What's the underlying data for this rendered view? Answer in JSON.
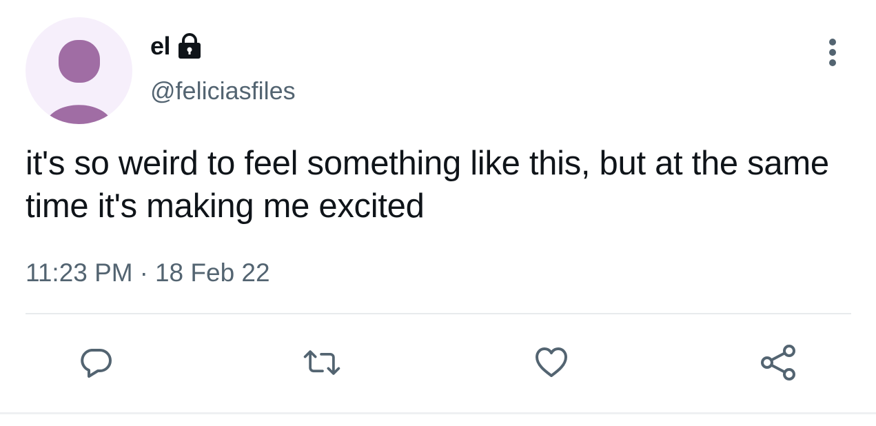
{
  "author": {
    "display_name": "el",
    "handle": "@feliciasfiles",
    "protected_icon": "lock-icon",
    "avatar_icon": "default-profile-icon"
  },
  "tweet": {
    "text": "it's so weird to feel something like this, but at the same time it's making me excited",
    "time": "11:23 PM",
    "separator": "·",
    "date": "18 Feb 22"
  },
  "actions": {
    "reply": "reply-icon",
    "retweet": "retweet-icon",
    "like": "heart-icon",
    "share": "share-icon",
    "more": "more-vertical-icon"
  },
  "colors": {
    "text": "#0f1419",
    "secondary": "#536471",
    "avatar_bg": "#f6effb",
    "avatar_fg": "#a06da4",
    "divider": "#e8ebed"
  }
}
